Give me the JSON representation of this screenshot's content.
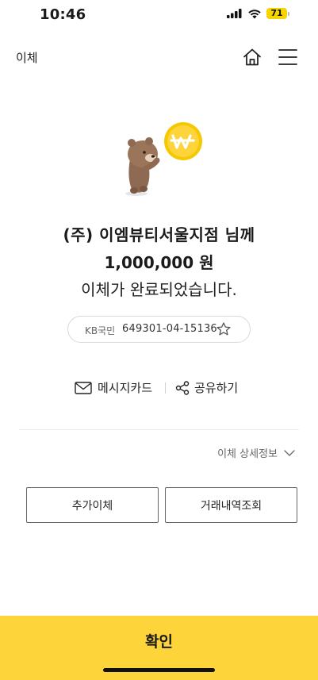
{
  "status_bar": {
    "time": "10:46",
    "battery": "71"
  },
  "header": {
    "title": "이체"
  },
  "transfer": {
    "recipient": "(주) 이엠뷰티서울지점 님께",
    "amount": "1,000,000 원",
    "message": "이체가 완료되었습니다."
  },
  "account": {
    "bank": "KB국민",
    "number": "649301-04-15136"
  },
  "actions": {
    "message_card": "메시지카드",
    "share": "공유하기"
  },
  "detail_toggle": "이체 상세정보",
  "buttons": {
    "additional_transfer": "추가이체",
    "history": "거래내역조회",
    "confirm": "확인"
  },
  "colors": {
    "brand_yellow": "#fdd43a",
    "battery_yellow": "#f5d400"
  }
}
